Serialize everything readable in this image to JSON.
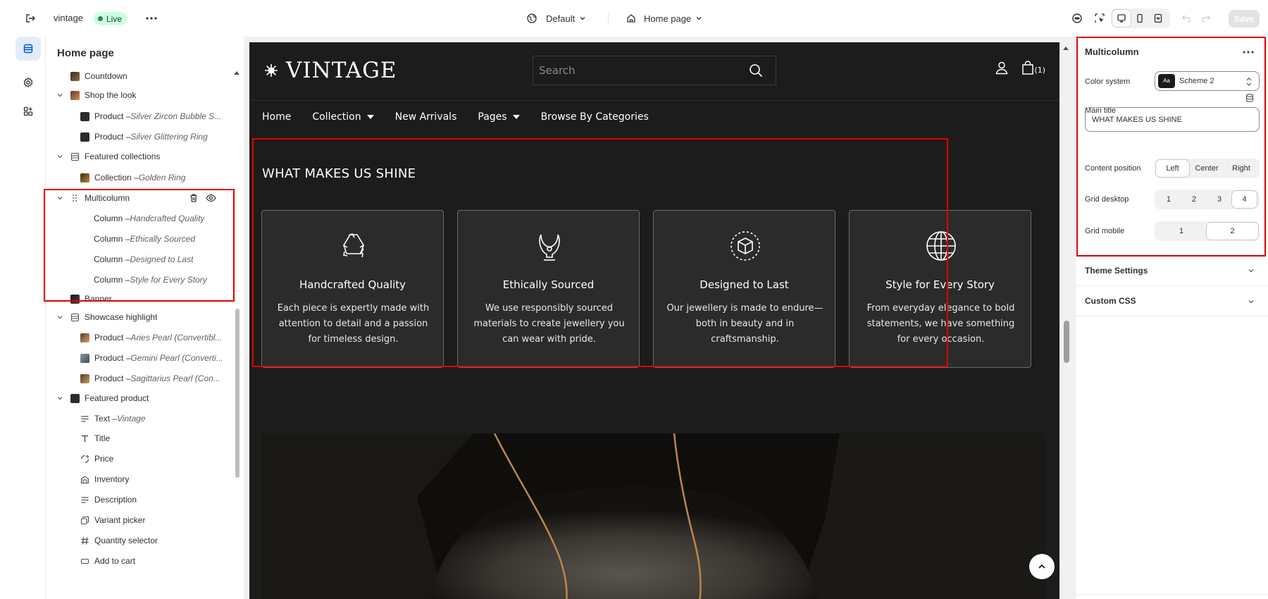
{
  "topbar": {
    "store_name": "vintage",
    "live_label": "Live",
    "theme_label": "Default",
    "page_label": "Home page",
    "save_label": "Save"
  },
  "sidebar": {
    "title": "Home page",
    "items": [
      {
        "label": "Countdown",
        "sub": ""
      },
      {
        "label": "Shop the look",
        "sub": ""
      },
      {
        "label": "Product – ",
        "sub": "Silver Zircon Bubble S..."
      },
      {
        "label": "Product – ",
        "sub": "Silver Glittering Ring"
      },
      {
        "label": "Featured collections",
        "sub": ""
      },
      {
        "label": "Collection – ",
        "sub": "Golden Ring"
      },
      {
        "label": "Multicolumn",
        "sub": ""
      },
      {
        "label": "Column – ",
        "sub": "Handcrafted Quality"
      },
      {
        "label": "Column – ",
        "sub": "Ethically Sourced"
      },
      {
        "label": "Column – ",
        "sub": "Designed to Last"
      },
      {
        "label": "Column – ",
        "sub": "Style for Every Story"
      },
      {
        "label": "Banner",
        "sub": ""
      },
      {
        "label": "Showcase highlight",
        "sub": ""
      },
      {
        "label": "Product – ",
        "sub": "Aries Pearl (Convertibl..."
      },
      {
        "label": "Product – ",
        "sub": "Gemini Pearl (Converti..."
      },
      {
        "label": "Product – ",
        "sub": "Sagittarius Pearl (Con..."
      },
      {
        "label": "Featured product",
        "sub": ""
      },
      {
        "label": "Text – ",
        "sub": "Vintage"
      },
      {
        "label": "Title",
        "sub": ""
      },
      {
        "label": "Price",
        "sub": ""
      },
      {
        "label": "Inventory",
        "sub": ""
      },
      {
        "label": "Description",
        "sub": ""
      },
      {
        "label": "Variant picker",
        "sub": ""
      },
      {
        "label": "Quantity selector",
        "sub": ""
      },
      {
        "label": "Add to cart",
        "sub": ""
      }
    ]
  },
  "preview": {
    "logo": "VINTAGE",
    "search_placeholder": "Search",
    "cart_count": "(1)",
    "nav": [
      {
        "label": "Home",
        "dropdown": false
      },
      {
        "label": "Collection",
        "dropdown": true
      },
      {
        "label": "New Arrivals",
        "dropdown": false
      },
      {
        "label": "Pages",
        "dropdown": true
      },
      {
        "label": "Browse By Categories",
        "dropdown": false
      }
    ],
    "multicolumn": {
      "title": "WHAT MAKES US SHINE",
      "columns": [
        {
          "icon": "recycle-icon",
          "heading": "Handcrafted Quality",
          "text": "Each piece is expertly made with attention to detail and a passion for timeless design."
        },
        {
          "icon": "necklace-icon",
          "heading": "Ethically Sourced",
          "text": "We use responsibly sourced materials to create jewellery you can wear with pride."
        },
        {
          "icon": "box-icon",
          "heading": "Designed to Last",
          "text": "Our jewellery is made to endure—both in beauty and in craftsmanship."
        },
        {
          "icon": "globe-icon",
          "heading": "Style for Every Story",
          "text": "From everyday elegance to bold statements, we have something for every occasion."
        }
      ]
    }
  },
  "settings": {
    "title": "Multicolumn",
    "color_system_label": "Color system",
    "color_scheme_value": "Scheme 2",
    "color_swatch_text": "Aa",
    "main_title_label": "Main title",
    "main_title_value": "WHAT MAKES US SHINE",
    "content_position_label": "Content position",
    "content_position_options": [
      "Left",
      "Center",
      "Right"
    ],
    "content_position_selected": "Left",
    "grid_desktop_label": "Grid desktop",
    "grid_desktop_options": [
      "1",
      "2",
      "3",
      "4"
    ],
    "grid_desktop_selected": "4",
    "grid_mobile_label": "Grid mobile",
    "grid_mobile_options": [
      "1",
      "2"
    ],
    "grid_mobile_selected": "2",
    "theme_settings_label": "Theme Settings",
    "custom_css_label": "Custom CSS"
  }
}
